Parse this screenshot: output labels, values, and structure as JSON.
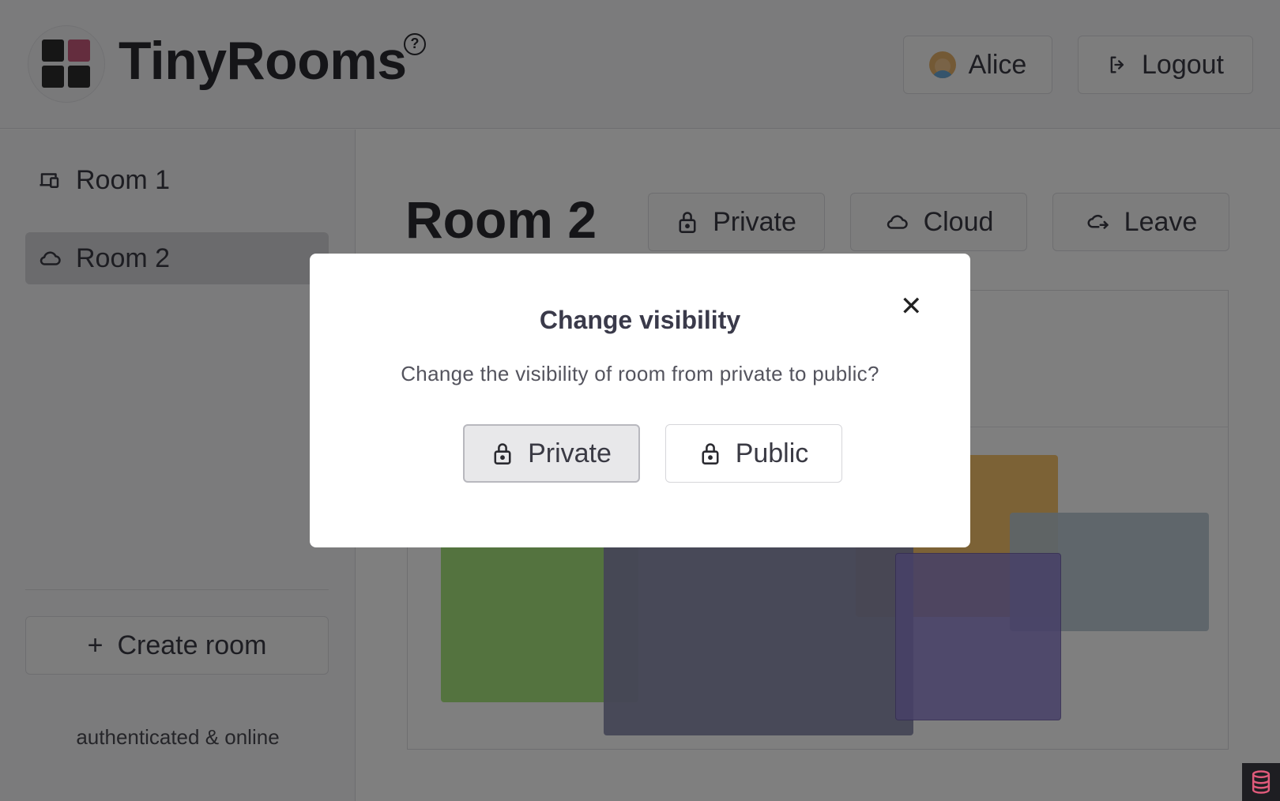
{
  "app": {
    "title": "TinyRooms",
    "help_symbol": "?"
  },
  "header": {
    "user_label": "Alice",
    "logout_label": "Logout"
  },
  "sidebar": {
    "items": [
      {
        "label": "Room 1",
        "icon": "devices-icon",
        "selected": false
      },
      {
        "label": "Room 2",
        "icon": "cloud-icon",
        "selected": true
      }
    ],
    "create_label": "Create room",
    "create_icon": "+",
    "status": "authenticated & online"
  },
  "room": {
    "title": "Room 2",
    "buttons": {
      "private_label": "Private",
      "cloud_label": "Cloud",
      "leave_label": "Leave"
    }
  },
  "modal": {
    "title": "Change visibility",
    "message": "Change the visibility of room from private to public?",
    "close_symbol": "✕",
    "options": {
      "private_label": "Private",
      "public_label": "Public"
    },
    "selected": "Private"
  },
  "colors": {
    "shape_green": "#a8e77e",
    "shape_navy": "#8b8cad",
    "shape_orange": "#f8c46c",
    "shape_slate": "#b8c8d2",
    "shape_purple": "#8e80d0",
    "logo_accent": "#c85a7c"
  }
}
